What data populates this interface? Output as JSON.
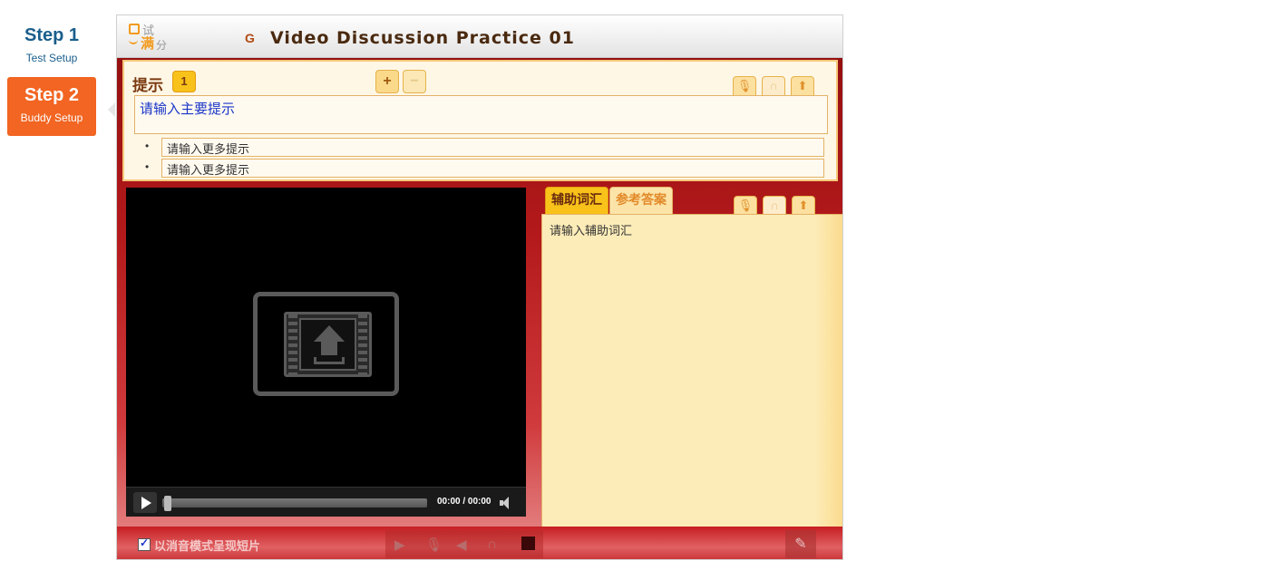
{
  "steps": [
    {
      "num": "Step 1",
      "label": "Test Setup",
      "active": false
    },
    {
      "num": "Step 2",
      "label": "Buddy Setup",
      "active": true
    }
  ],
  "header": {
    "logo": {
      "top": "试",
      "big": "满",
      "small": "分"
    },
    "icon_letter": "G",
    "title": "Video Discussion Practice 01"
  },
  "hint": {
    "label": "提示",
    "count": "1",
    "plus": "+",
    "minus": "−",
    "main_placeholder": "请输入主要提示",
    "more_items": [
      "请输入更多提示",
      "请输入更多提示"
    ]
  },
  "video": {
    "time": "00:00 / 00:00"
  },
  "tabs": {
    "vocab": "辅助词汇",
    "answer": "参考答案"
  },
  "vocab": {
    "text": "请输入辅助词汇"
  },
  "bottom": {
    "mute_label": "以消音模式呈现短片",
    "mute_checked": true
  },
  "colors": {
    "accent": "#f26522",
    "step_text": "#1a5e8c",
    "frame_red": "#b3191b",
    "panel_cream": "#fcecb8"
  }
}
